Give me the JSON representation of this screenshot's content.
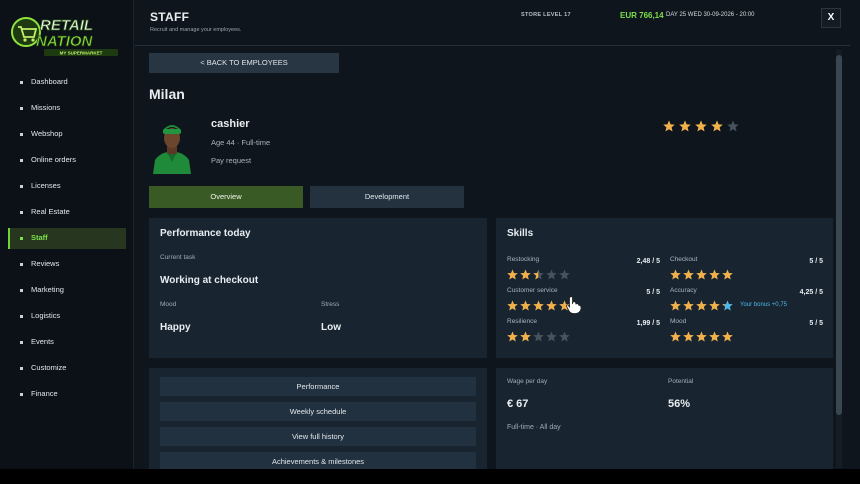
{
  "sidebar": {
    "logo": {
      "top": "RETAIL",
      "bottom": "NATION",
      "tag": "MY SUPERMARKET"
    },
    "items": [
      {
        "label": "Dashboard"
      },
      {
        "label": "Missions"
      },
      {
        "label": "Webshop"
      },
      {
        "label": "Online orders"
      },
      {
        "label": "Licenses"
      },
      {
        "label": "Real Estate"
      },
      {
        "label": "Staff",
        "active": true
      },
      {
        "label": "Reviews"
      },
      {
        "label": "Marketing"
      },
      {
        "label": "Logistics"
      },
      {
        "label": "Events"
      },
      {
        "label": "Customize"
      },
      {
        "label": "Finance"
      }
    ]
  },
  "header": {
    "title": "STAFF",
    "subtitle": "Recruit and manage your employees.",
    "store_level": "STORE LEVEL 17",
    "money": "EUR 766,14",
    "date": "DAY 25  WED  30-09-2026  -  20:00",
    "close_label": "X"
  },
  "employee": {
    "back_label": "<  BACK TO EMPLOYEES",
    "name": "Milan",
    "role": "cashier",
    "age": "Age 44 · Full-time",
    "pay_request": "Pay request",
    "rating_stars": 4,
    "rating_max": 5
  },
  "tabs": [
    {
      "label": "Overview",
      "active": true
    },
    {
      "label": "Development",
      "active": false
    }
  ],
  "performance": {
    "title": "Performance today",
    "current_task_label": "Current task",
    "current_task": "Working at checkout",
    "mood_label": "Mood",
    "mood": "Happy",
    "stress_label": "Stress",
    "stress": "Low"
  },
  "skills": {
    "title": "Skills",
    "items": [
      {
        "name": "Restocking",
        "value": "2,48 / 5",
        "stars": 2.48
      },
      {
        "name": "Checkout",
        "value": "5 / 5",
        "stars": 5
      },
      {
        "name": "Customer service",
        "value": "5 / 5",
        "stars": 5
      },
      {
        "name": "Accuracy",
        "value": "4,25 / 5",
        "stars": 4.25,
        "bonus": "Your bonus +0,75",
        "bonus_stars": 0.75
      },
      {
        "name": "Resilience",
        "value": "1,99 / 5",
        "stars": 1.99
      },
      {
        "name": "Mood",
        "value": "5 / 5",
        "stars": 5
      }
    ]
  },
  "actions": [
    {
      "label": "Performance"
    },
    {
      "label": "Weekly schedule"
    },
    {
      "label": "View full history"
    },
    {
      "label": "Achievements & milestones"
    }
  ],
  "wage": {
    "wage_label": "Wage per day",
    "wage": "€ 67",
    "potential_label": "Potential",
    "potential": "56%",
    "schedule": "Full-time · All day"
  },
  "colors": {
    "accent_green": "#7ee04a",
    "star_gold": "#f0b04a",
    "star_empty": "#46525c",
    "bonus_blue": "#4fb8e8"
  }
}
